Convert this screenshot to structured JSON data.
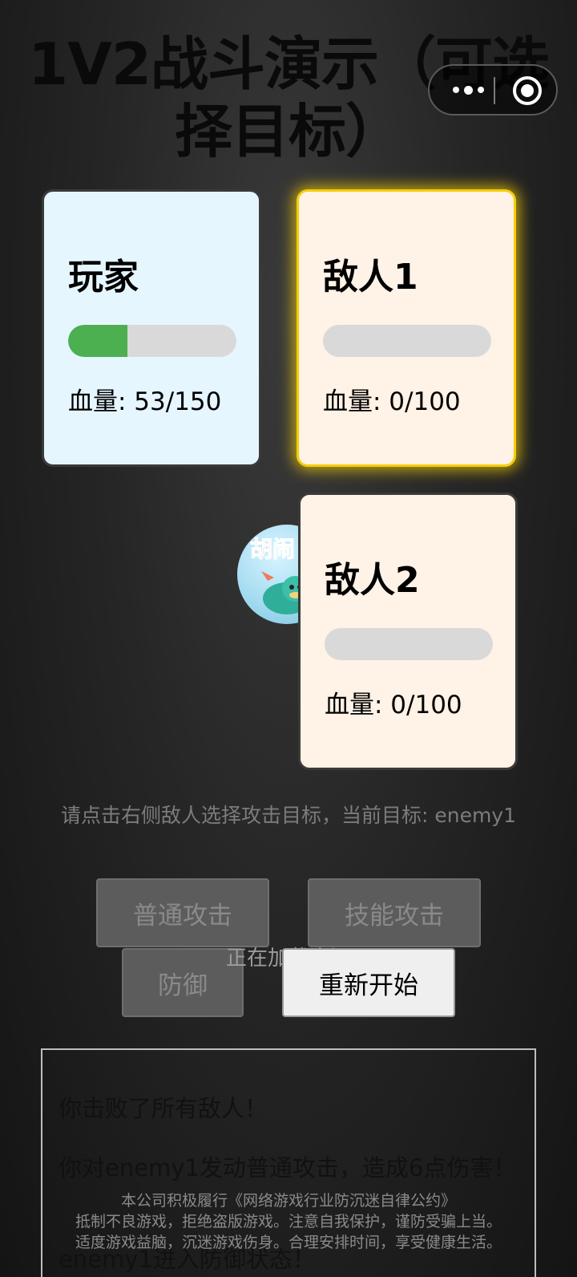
{
  "page": {
    "title": "1V2战斗演示（可选择目标）"
  },
  "capsule": {
    "more_icon": "more-dots-icon",
    "close_icon": "miniprogram-close-icon"
  },
  "player": {
    "name": "玩家",
    "hp_text": "血量: 53/150",
    "hp_current": 53,
    "hp_max": 150,
    "bar_color": "#4caf50"
  },
  "enemies": [
    {
      "name": "敌人1",
      "hp_text": "血量: 0/100",
      "hp_current": 0,
      "hp_max": 100,
      "selected": true,
      "highlight_color": "#f4cd05"
    },
    {
      "name": "敌人2",
      "hp_text": "血量: 0/100",
      "hp_current": 0,
      "hp_max": 100,
      "selected": false
    }
  ],
  "avatar_icon": "game-mascot-avatar",
  "hint": "请点击右侧敌人选择攻击目标，当前目标: enemy1",
  "buttons": {
    "normal_attack": "普通攻击",
    "skill_attack": "技能攻击",
    "defend": "防御",
    "restart": "重新开始"
  },
  "loading_text": "正在加载资源",
  "log": [
    "你击败了所有敌人！",
    "你对enemy1发动普通攻击，造成6点伤害！",
    "enemy1进入防御状态！"
  ],
  "notice": {
    "line1": "本公司积极履行《网络游戏行业防沉迷自律公约》",
    "line2": "抵制不良游戏，拒绝盗版游戏。注意自我保护，谨防受骗上当。",
    "line3": "适度游戏益脑，沉迷游戏伤身。合理安排时间，享受健康生活。"
  }
}
